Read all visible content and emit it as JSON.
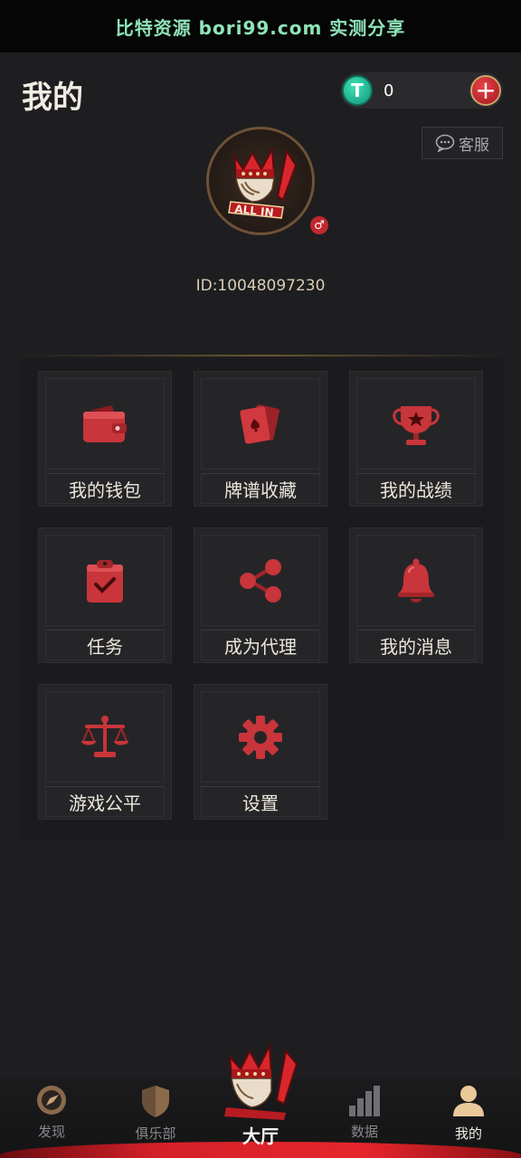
{
  "banner": {
    "text": "比特资源 bori99.com 实测分享"
  },
  "header": {
    "title": "我的"
  },
  "balance": {
    "coin_symbol": "T",
    "value": "0",
    "add_symbol": "+"
  },
  "service": {
    "label": "客服"
  },
  "profile": {
    "gender_symbol": "♂",
    "user_id": "ID:10048097230",
    "avatar_text": "ALL IN"
  },
  "grid": {
    "items": [
      {
        "label": "我的钱包",
        "icon": "wallet-icon"
      },
      {
        "label": "牌谱收藏",
        "icon": "cards-icon"
      },
      {
        "label": "我的战绩",
        "icon": "trophy-icon"
      },
      {
        "label": "任务",
        "icon": "task-clipboard-icon"
      },
      {
        "label": "成为代理",
        "icon": "share-icon"
      },
      {
        "label": "我的消息",
        "icon": "bell-icon"
      },
      {
        "label": "游戏公平",
        "icon": "scales-icon"
      },
      {
        "label": "设置",
        "icon": "gear-icon"
      }
    ]
  },
  "nav": {
    "items": [
      {
        "label": "发现",
        "icon": "compass-icon"
      },
      {
        "label": "俱乐部",
        "icon": "shield-icon"
      },
      {
        "label": "大厅",
        "icon": "lobby-mascot-icon"
      },
      {
        "label": "数据",
        "icon": "bar-chart-icon"
      },
      {
        "label": "我的",
        "icon": "person-icon"
      }
    ],
    "active": "我的"
  },
  "colors": {
    "accent_red": "#c0282e",
    "gold": "#c9a56a",
    "coin_green": "#1fb38e"
  }
}
